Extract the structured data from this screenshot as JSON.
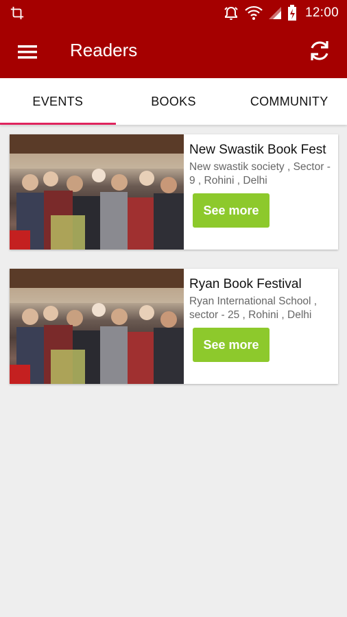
{
  "status_bar": {
    "time": "12:00",
    "icons": [
      "crop-icon",
      "alarm-icon",
      "wifi-icon",
      "signal-icon",
      "battery-icon"
    ]
  },
  "app_bar": {
    "title": "Readers",
    "menu_icon": "hamburger-menu-icon",
    "refresh_icon": "refresh-icon",
    "background": "#a50000"
  },
  "tabs": [
    {
      "label": "EVENTS",
      "active": true
    },
    {
      "label": "BOOKS",
      "active": false
    },
    {
      "label": "COMMUNITY",
      "active": false
    }
  ],
  "accent_color": "#e0245e",
  "button_color": "#8dc92c",
  "events": [
    {
      "title": "New Swastik Book Fest",
      "address": "New swastik society , Sector - 9 , Rohini , Delhi",
      "button_label": "See more"
    },
    {
      "title": "Ryan Book Festival",
      "address": "Ryan International School , sector - 25 , Rohini , Delhi",
      "button_label": "See more"
    }
  ]
}
